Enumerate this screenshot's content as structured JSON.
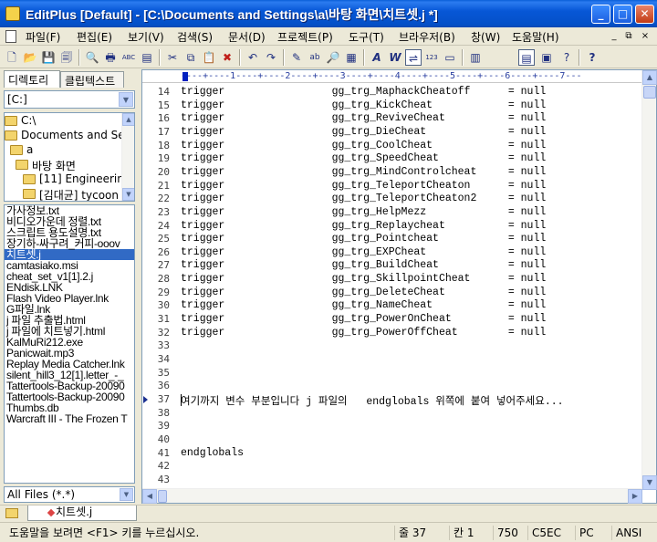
{
  "window": {
    "title": "EditPlus [Default] - [C:\\Documents and Settings\\a\\바탕 화면\\치트셋.j *]",
    "min": "_",
    "max": "□",
    "close": "✕"
  },
  "menu": {
    "items": [
      "파일(F)",
      "편집(E)",
      "보기(V)",
      "검색(S)",
      "문서(D)",
      "프로젝트(P)",
      "도구(T)",
      "브라우저(B)",
      "창(W)",
      "도움말(H)"
    ],
    "mdi": [
      "_",
      "⧉",
      "×"
    ]
  },
  "toolbar": {
    "icons": [
      "new-icon",
      "open-icon",
      "save-icon",
      "save-all-icon",
      "print-preview-icon",
      "print-icon",
      "spell-icon",
      "template-icon",
      "cut-icon",
      "copy-icon",
      "paste-icon",
      "delete-icon",
      "undo-icon",
      "redo-icon",
      "find-icon",
      "replace-icon",
      "find-in-files-icon",
      "goto-icon",
      "font-icon",
      "italic-w-icon",
      "word-wrap-icon",
      "line-number-icon",
      "ruler-icon",
      "columns-icon",
      "sidebar-icon",
      "output-icon",
      "help-icon"
    ],
    "glyphs": [
      "🗋",
      "📂",
      "💾",
      "🗐",
      "🔍",
      "🖶",
      "ABC",
      "▤",
      "✂",
      "⧉",
      "📋",
      "✖",
      "↶",
      "↷",
      "✎",
      "ab",
      "🔎",
      "▦",
      "A",
      "W",
      "⇌",
      "123",
      "▭",
      "▥",
      "▤",
      "▣",
      "?"
    ]
  },
  "left_panel": {
    "tab_directory": "디렉토리",
    "tab_cliptext": "클립텍스트",
    "drive": "[C:]",
    "tree": [
      {
        "label": "C:\\",
        "indent": 0
      },
      {
        "label": "Documents and Se",
        "indent": 1
      },
      {
        "label": "a",
        "indent": 2
      },
      {
        "label": "바탕 화면",
        "indent": 3
      },
      {
        "label": "[11] Engineering",
        "indent": 4
      },
      {
        "label": "[김대균] tycoon",
        "indent": 4
      }
    ],
    "files": [
      "가사정보.txt",
      "비디오가운데 정렬.txt",
      "스크립트 용도설명.txt",
      "장기하-싸구려_커피-ooov",
      "치트셋.j",
      "camtasiako.msi",
      "cheat_set_v1[1].2.j",
      "ENdisk.LNK",
      "Flash Video Player.lnk",
      "G파일.lnk",
      "j 파일 추출법.html",
      "j 파일에 치트넣기.html",
      "KalMuRi212.exe",
      "Panicwait.mp3",
      "Replay Media Catcher.lnk",
      "silent_hill3_12[1].letter_-_",
      "Tattertools-Backup-20090",
      "Tattertools-Backup-20090",
      "Thumbs.db",
      "Warcraft III - The Frozen T"
    ],
    "selected_file_index": 4,
    "filter": "All Files (*.*)"
  },
  "editor": {
    "ruler": "----+----1----+----2----+----3----+----4----+----5----+----6----+----7---",
    "lines": [
      {
        "n": "14",
        "text": "trigger                 gg_trg_MaphackCheatoff      = null"
      },
      {
        "n": "15",
        "text": "trigger                 gg_trg_KickCheat            = null"
      },
      {
        "n": "16",
        "text": "trigger                 gg_trg_ReviveCheat          = null"
      },
      {
        "n": "17",
        "text": "trigger                 gg_trg_DieCheat             = null"
      },
      {
        "n": "18",
        "text": "trigger                 gg_trg_CoolCheat            = null"
      },
      {
        "n": "19",
        "text": "trigger                 gg_trg_SpeedCheat           = null"
      },
      {
        "n": "20",
        "text": "trigger                 gg_trg_MindControlcheat     = null"
      },
      {
        "n": "21",
        "text": "trigger                 gg_trg_TeleportCheaton      = null"
      },
      {
        "n": "22",
        "text": "trigger                 gg_trg_TeleportCheaton2     = null"
      },
      {
        "n": "23",
        "text": "trigger                 gg_trg_HelpMezz             = null"
      },
      {
        "n": "24",
        "text": "trigger                 gg_trg_Replaycheat          = null"
      },
      {
        "n": "25",
        "text": "trigger                 gg_trg_Pointcheat           = null"
      },
      {
        "n": "26",
        "text": "trigger                 gg_trg_EXPCheat             = null"
      },
      {
        "n": "27",
        "text": "trigger                 gg_trg_BuildCheat           = null"
      },
      {
        "n": "28",
        "text": "trigger                 gg_trg_SkillpointCheat      = null"
      },
      {
        "n": "29",
        "text": "trigger                 gg_trg_DeleteCheat          = null"
      },
      {
        "n": "30",
        "text": "trigger                 gg_trg_NameCheat            = null"
      },
      {
        "n": "31",
        "text": "trigger                 gg_trg_PowerOnCheat         = null"
      },
      {
        "n": "32",
        "text": "trigger                 gg_trg_PowerOffCheat        = null"
      },
      {
        "n": "33",
        "text": ""
      },
      {
        "n": "34",
        "text": ""
      },
      {
        "n": "35",
        "text": ""
      },
      {
        "n": "36",
        "text": ""
      },
      {
        "n": "37",
        "text": "여기까지 변수 부분입니다 j 파일의   endglobals 위쪽에 붙여 넣어주세요..."
      },
      {
        "n": "38",
        "text": ""
      },
      {
        "n": "39",
        "text": ""
      },
      {
        "n": "40",
        "text": ""
      },
      {
        "n": "41",
        "text": "endglobals"
      },
      {
        "n": "42",
        "text": ""
      },
      {
        "n": "43",
        "text": ""
      }
    ],
    "current_line_index": 23
  },
  "doc_tab": {
    "label": "치트셋.j"
  },
  "status": {
    "help": "도움말을 보려면 <F1> 키를 누르십시오.",
    "line": "줄 37",
    "col": "칸 1",
    "size": "750",
    "code": "C5EC",
    "mode": "PC",
    "encoding": "ANSI"
  }
}
